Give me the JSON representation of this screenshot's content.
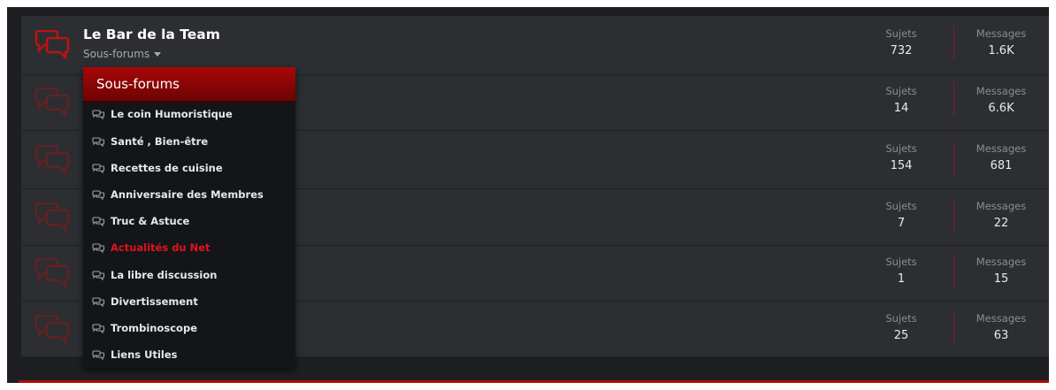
{
  "colors": {
    "accent": "#b00c0c",
    "active_link": "#e0141a",
    "background": "#1d1f22",
    "node_bg": "#2c2e32"
  },
  "main_node": {
    "title": "Le Bar de la Team",
    "subforums_label": "Sous-forums",
    "icon": "chat-bubbles-icon"
  },
  "stat_labels": {
    "topics": "Sujets",
    "messages": "Messages"
  },
  "rows": [
    {
      "topics": "732",
      "messages": "1.6K"
    },
    {
      "topics": "14",
      "messages": "6.6K"
    },
    {
      "topics": "154",
      "messages": "681"
    },
    {
      "topics": "7",
      "messages": "22"
    },
    {
      "topics": "1",
      "messages": "15"
    },
    {
      "topics": "25",
      "messages": "63"
    }
  ],
  "subforums_menu": {
    "title": "Sous-forums",
    "item_icon": "chat-bubbles-outline-icon",
    "items": [
      {
        "label": "Le coin Humoristique"
      },
      {
        "label": "Santé , Bien-être"
      },
      {
        "label": "Recettes de cuisine"
      },
      {
        "label": "Anniversaire des Membres"
      },
      {
        "label": "Truc & Astuce"
      },
      {
        "label": "Actualités du Net",
        "active": true
      },
      {
        "label": "La libre discussion"
      },
      {
        "label": "Divertissement"
      },
      {
        "label": "Trombinoscope"
      },
      {
        "label": "Liens Utiles"
      }
    ]
  }
}
